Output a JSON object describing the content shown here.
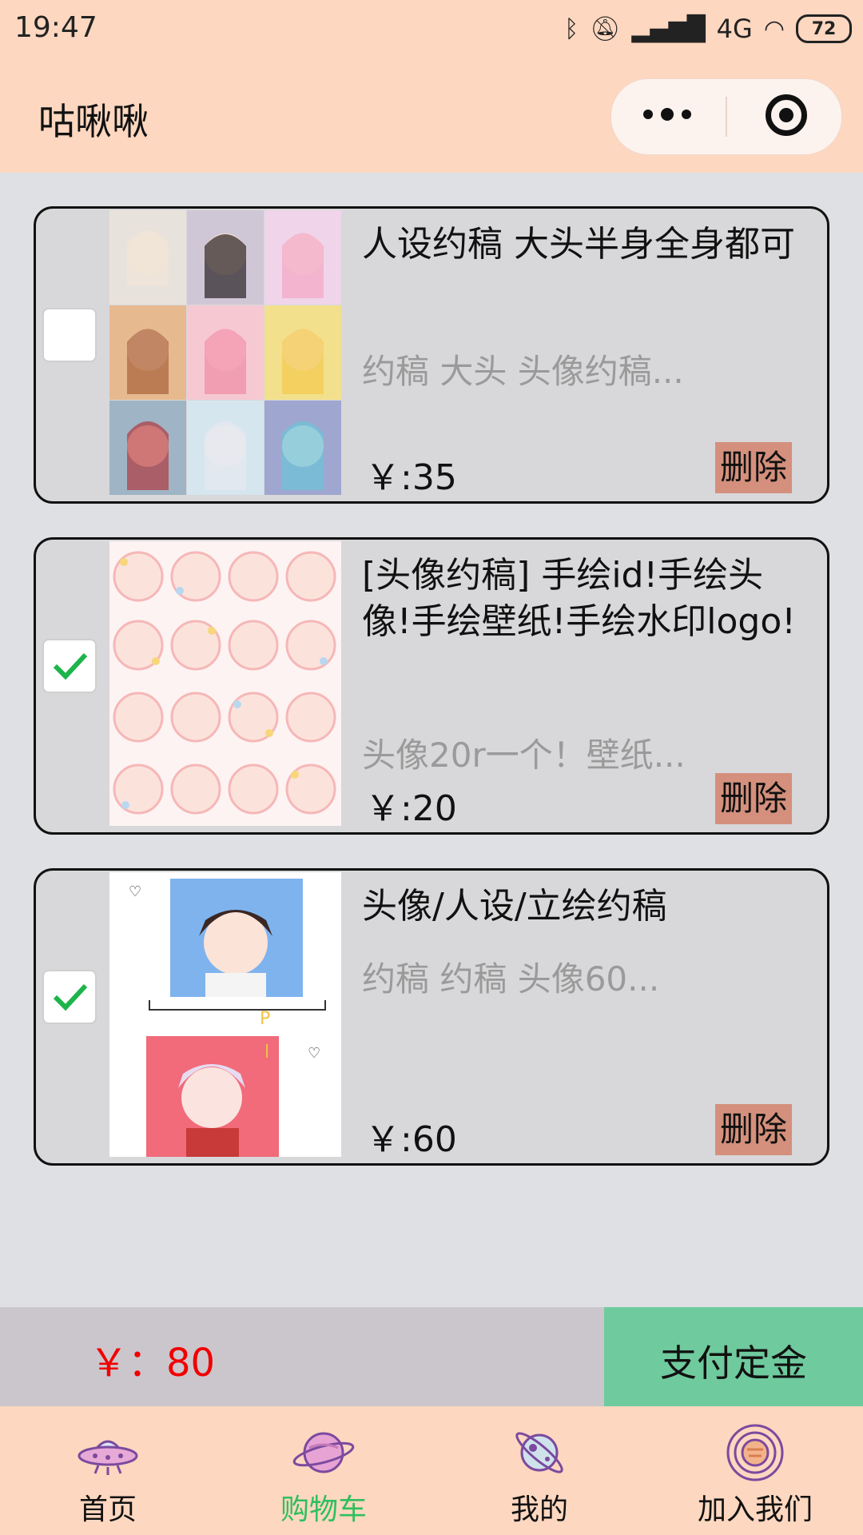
{
  "status_bar": {
    "time": "19:47",
    "network": "4G",
    "battery": "72"
  },
  "nav": {
    "title": "咕啾啾"
  },
  "cart_items": [
    {
      "title": "人设约稿 大头半身全身都可",
      "desc": "约稿 大头 头像约稿...",
      "price": "￥:35",
      "delete_label": "删除",
      "checked": false,
      "image": "anime-character-grid"
    },
    {
      "title": "[头像约稿] 手绘id!手绘头像!手绘壁纸!手绘水印logo!",
      "desc": "头像20r一个！壁纸...",
      "price": "￥:20",
      "delete_label": "删除",
      "checked": true,
      "image": "cute-avatar-stickers"
    },
    {
      "title": "头像/人设/立绘约稿",
      "desc": "约稿 约稿 头像60...",
      "price": "￥:60",
      "delete_label": "删除",
      "checked": true,
      "image": "two-anime-portraits"
    }
  ],
  "checkout": {
    "total": "￥：80",
    "pay_label": "支付定金"
  },
  "tabs": [
    {
      "label": "首页",
      "icon": "ufo-icon",
      "active": false
    },
    {
      "label": "购物车",
      "icon": "planet-icon",
      "active": true
    },
    {
      "label": "我的",
      "icon": "satellite-planet-icon",
      "active": false
    },
    {
      "label": "加入我们",
      "icon": "orbit-planet-icon",
      "active": false
    }
  ],
  "colors": {
    "header_bg": "#fdd7c0",
    "pay_button": "#6fca9e",
    "delete_button": "#d4907c",
    "total_price": "#f00000",
    "active_tab": "#2fbf5e"
  }
}
